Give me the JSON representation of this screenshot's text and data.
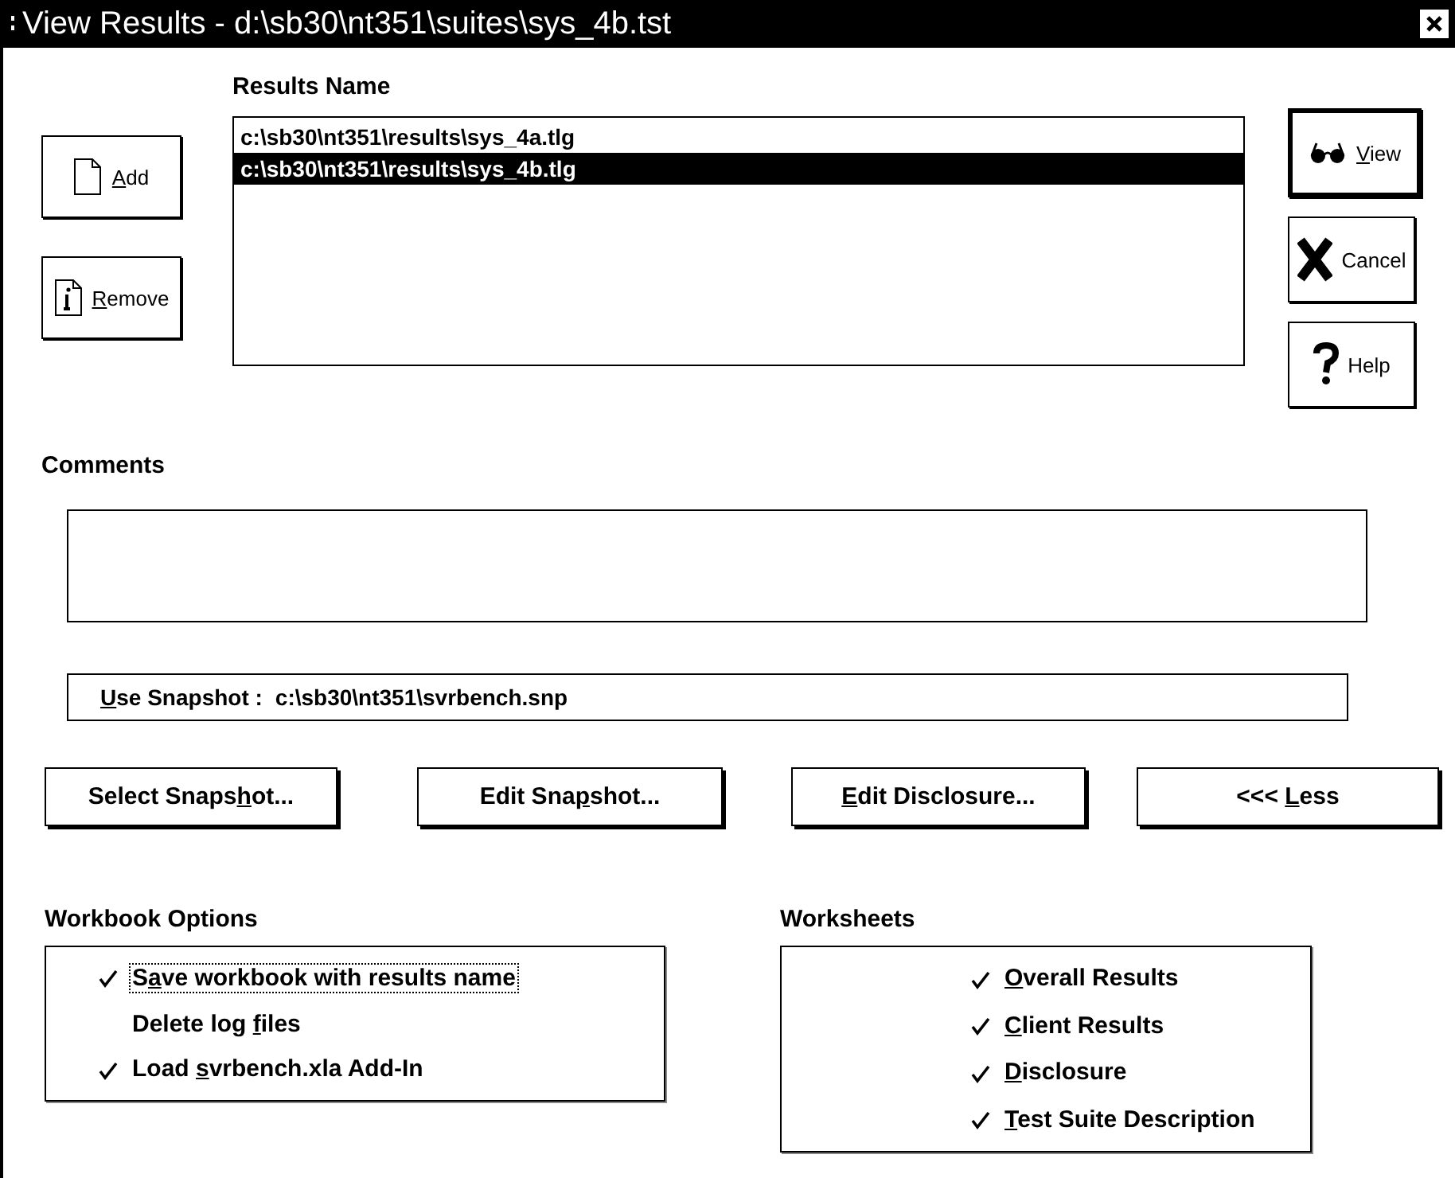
{
  "window": {
    "title": "View Results - d:\\sb30\\nt351\\suites\\sys_4b.tst"
  },
  "results_label": {
    "post": "Results Name"
  },
  "left_buttons": [
    {
      "kind": "add",
      "key": "A",
      "post": "dd"
    },
    {
      "kind": "remove",
      "key": "R",
      "post": "emove"
    }
  ],
  "results": [
    {
      "text": "c:\\sb30\\nt351\\results\\sys_4a.tlg",
      "selected": false
    },
    {
      "text": "c:\\sb30\\nt351\\results\\sys_4b.tlg",
      "selected": true
    }
  ],
  "right_buttons": [
    {
      "kind": "view",
      "key": "V",
      "post": "iew",
      "default": true
    },
    {
      "kind": "cancel",
      "post": "Cancel",
      "default": false
    },
    {
      "kind": "help",
      "post": "Help",
      "default": false
    }
  ],
  "comments_label": "Comments",
  "snapshot": {
    "key": "U",
    "post": "se Snapshot :",
    "value": "c:\\sb30\\nt351\\svrbench.snp"
  },
  "action_buttons": [
    {
      "pre": "Select Snaps",
      "key": "h",
      "post": "ot..."
    },
    {
      "pre": "Edit Sna",
      "key": "p",
      "post": "shot..."
    },
    {
      "key": "E",
      "post": "dit Disclosure..."
    },
    {
      "pre": "<<< ",
      "key": "L",
      "post": "ess"
    }
  ],
  "workbook_options": {
    "title": "Workbook Options",
    "items": [
      {
        "pre": "S",
        "key": "a",
        "post": "ve workbook with results name",
        "checked": true,
        "focused": true
      },
      {
        "pre": "Delete log ",
        "key": "f",
        "post": "iles",
        "checked": false,
        "focused": false
      },
      {
        "pre": "Load ",
        "key": "s",
        "post": "vrbench.xla Add-In",
        "checked": true,
        "focused": false
      }
    ]
  },
  "worksheets": {
    "title": "Worksheets",
    "items": [
      {
        "key": "O",
        "post": "verall Results",
        "checked": true
      },
      {
        "key": "C",
        "post": "lient Results",
        "checked": true
      },
      {
        "key": "D",
        "post": "isclosure",
        "checked": true
      },
      {
        "key": "T",
        "post": "est Suite Description",
        "checked": true
      }
    ]
  }
}
